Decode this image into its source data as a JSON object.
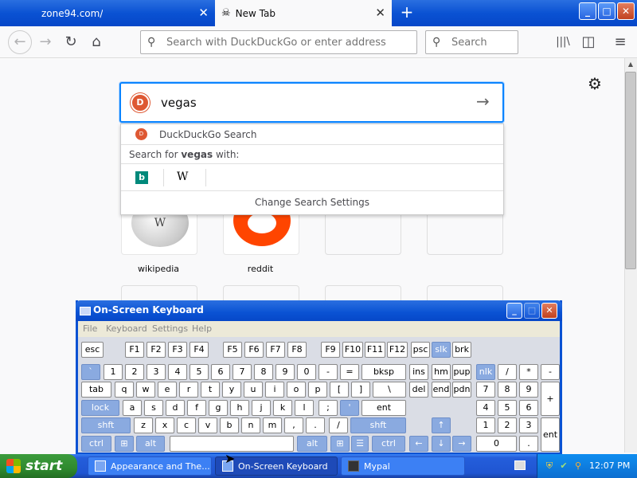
{
  "browser": {
    "tabs": [
      {
        "label": "zone94.com/"
      },
      {
        "label": "New Tab"
      }
    ],
    "close_glyph": "✕",
    "new_tab_glyph": "+",
    "window_buttons": {
      "min": "_",
      "max": "□",
      "close": "✕"
    },
    "nav": {
      "back": "←",
      "forward": "→",
      "reload": "↻",
      "home": "⌂",
      "library": "|||\\",
      "sidebar": "◫",
      "menu": "≡"
    },
    "url_placeholder": "Search with DuckDuckGo or enter address",
    "search_placeholder": "Search"
  },
  "newtab": {
    "gear": "⚙",
    "search_query": "vegas",
    "go_arrow": "→",
    "suggestions": {
      "engine_label": "DuckDuckGo Search",
      "search_for_prefix": "Search for ",
      "search_for_term": "vegas",
      "search_for_suffix": " with:",
      "bing_glyph": "b",
      "wiki_glyph": "W",
      "change_settings": "Change Search Settings"
    },
    "top_sites": [
      {
        "label": "wikipedia",
        "glyph": "W"
      },
      {
        "label": "reddit"
      }
    ]
  },
  "osk": {
    "title": "On-Screen Keyboard",
    "menu": [
      "File",
      "Keyboard",
      "Settings",
      "Help"
    ],
    "buttons": {
      "min": "_",
      "max": "□",
      "close": "✕"
    },
    "rows": {
      "fn": [
        "esc",
        "F1",
        "F2",
        "F3",
        "F4",
        "F5",
        "F6",
        "F7",
        "F8",
        "F9",
        "F10",
        "F11",
        "F12",
        "psc",
        "slk",
        "brk"
      ],
      "num": [
        "`",
        "1",
        "2",
        "3",
        "4",
        "5",
        "6",
        "7",
        "8",
        "9",
        "0",
        "-",
        "=",
        "bksp",
        "ins",
        "hm",
        "pup",
        "nlk",
        "/",
        "*",
        "-"
      ],
      "q": [
        "tab",
        "q",
        "w",
        "e",
        "r",
        "t",
        "y",
        "u",
        "i",
        "o",
        "p",
        "[",
        "]",
        "\\",
        "del",
        "end",
        "pdn",
        "7",
        "8",
        "9",
        "+"
      ],
      "a": [
        "lock",
        "a",
        "s",
        "d",
        "f",
        "g",
        "h",
        "j",
        "k",
        "l",
        ";",
        "'",
        "ent",
        "4",
        "5",
        "6"
      ],
      "z": [
        "shft",
        "z",
        "x",
        "c",
        "v",
        "b",
        "n",
        "m",
        ",",
        ".",
        "/",
        "shft",
        "↑",
        "1",
        "2",
        "3",
        "ent"
      ],
      "ctrl": [
        "ctrl",
        "alt",
        "",
        "alt",
        "ctrl",
        "←",
        "↓",
        "→",
        "0",
        "."
      ]
    }
  },
  "taskbar": {
    "start": "start",
    "tasks": [
      "Appearance and The...",
      "On-Screen Keyboard",
      "Mypal"
    ],
    "clock": "12:07 PM"
  },
  "colors": {
    "xp_blue": "#0a52d3",
    "focus_blue": "#0a84ff",
    "ddg_orange": "#de5833",
    "reddit_orange": "#ff4500",
    "start_green": "#2f8a2f"
  }
}
